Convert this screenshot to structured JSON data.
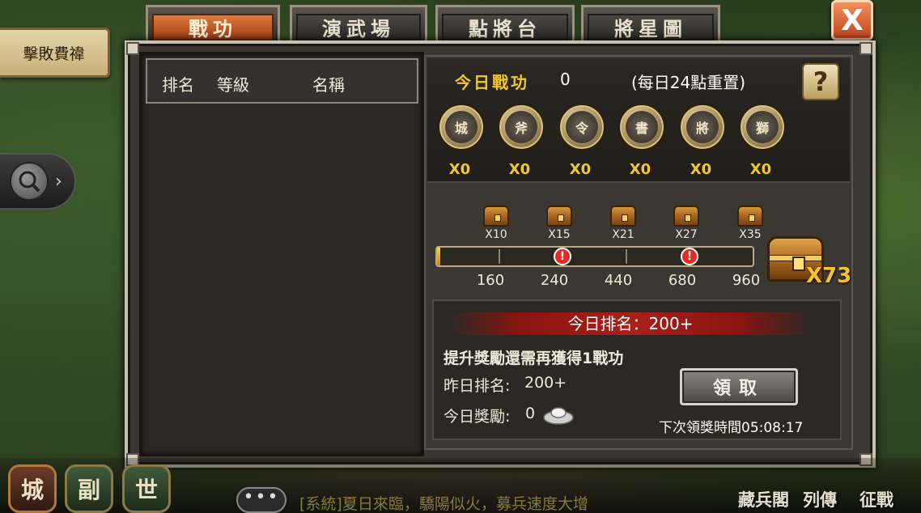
{
  "side": {
    "tag": "擊敗費禕"
  },
  "tabs": [
    {
      "label": "戰功",
      "active": true
    },
    {
      "label": "演武場",
      "active": false
    },
    {
      "label": "點將台",
      "active": false
    },
    {
      "label": "將星圖",
      "active": false
    }
  ],
  "close_label": "X",
  "rank_list": {
    "headers": {
      "rank": "排名",
      "level": "等級",
      "name": "名稱"
    }
  },
  "today": {
    "label": "今日戰功",
    "value": "0",
    "reset_note": "(每日24點重置)",
    "help": "?"
  },
  "medals": [
    {
      "icon": "fortress-icon",
      "glyph": "城",
      "count": "X0"
    },
    {
      "icon": "crossed-axes-icon",
      "glyph": "斧",
      "count": "X0"
    },
    {
      "icon": "command-token-icon",
      "glyph": "令",
      "count": "X0"
    },
    {
      "icon": "scroll-icon",
      "glyph": "書",
      "count": "X0"
    },
    {
      "icon": "general-portrait-icon",
      "glyph": "將",
      "count": "X0"
    },
    {
      "icon": "lion-knocker-icon",
      "glyph": "獅",
      "count": "X0"
    }
  ],
  "progress": {
    "fraction": 0.01,
    "chests": [
      "X10",
      "X15",
      "X21",
      "X27",
      "X35"
    ],
    "milestones": [
      "160",
      "240",
      "440",
      "680",
      "960"
    ],
    "big_chest_count": "X73"
  },
  "reward": {
    "today_rank": "今日排名：200+",
    "need_text": "提升獎勵還需再獲得1戰功",
    "yesterday_label": "昨日排名:",
    "yesterday_value": "200+",
    "today_reward_label": "今日獎勵:",
    "today_reward_value": "0",
    "claim_label": "領取",
    "next_time": "下次領獎時間05:08:17"
  },
  "bottom": {
    "buttons": [
      "城",
      "副",
      "世"
    ],
    "chat_dots": "•••",
    "chat_message": "[系統]夏日來臨，驕陽似火，募兵速度大增",
    "nav": [
      "藏兵閣",
      "列傳",
      "征戰"
    ]
  }
}
